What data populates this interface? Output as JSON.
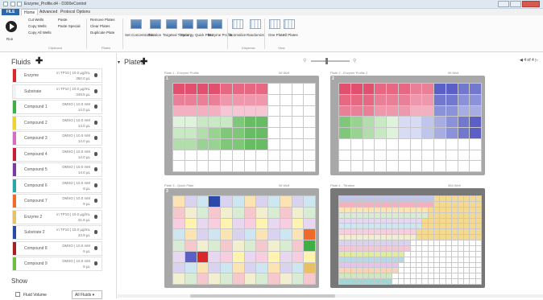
{
  "window": {
    "title": "Enzyme_Profile.d4 - D300eControl"
  },
  "tabs": [
    {
      "label": "FILE"
    },
    {
      "label": "Home"
    },
    {
      "label": "Advanced"
    },
    {
      "label": "Protocol Options"
    }
  ],
  "ribbon": {
    "run": "Run",
    "cut": "Cut Wells",
    "copy": "Copy Wells",
    "copy_all": "Copy All Wells",
    "paste": "Paste",
    "paste_special": "Paste Special",
    "remove_plates": "Remove Plates",
    "clear_plates": "Clear Plates",
    "duplicate_plate": "Duplicate Plate",
    "group_clipboard": "Clipboard",
    "group_plates": "Plates",
    "set_concentration": "Set Concentration",
    "titration": "Titration",
    "targeted_titration": "Targeted Titration",
    "synergy": "Synergy",
    "quick_plate": "Quick Plate",
    "enzyme_profile": "Enzyme Profile",
    "normalize": "Normalize",
    "randomize": "Randomize",
    "group_dispense": "Dispense",
    "one_plate": "One Plate",
    "all_plates": "All Plates",
    "group_view": "View"
  },
  "sidebar": {
    "header": "Fluids",
    "fluids": [
      {
        "name": "Enzyme",
        "conc": "in TP10 | 10.0 µg/mL",
        "vol": "350.0 µL",
        "color": "#d8282a"
      },
      {
        "name": "Substrate",
        "conc": "in TP10 | 10.0 µg/mL",
        "vol": "349.5 µL",
        "color": "#f2f2f2"
      },
      {
        "name": "Compound 1",
        "conc": "DMSO | 10.0 mM",
        "vol": "14.0 µL",
        "color": "#3cb043"
      },
      {
        "name": "Compound 2",
        "conc": "DMSO | 10.0 mM",
        "vol": "14.0 µL",
        "color": "#f1d22b"
      },
      {
        "name": "Compound 3",
        "conc": "DMSO | 10.0 mM",
        "vol": "14.0 µL",
        "color": "#d46cc4"
      },
      {
        "name": "Compound 4",
        "conc": "DMSO | 10.0 mM",
        "vol": "14.0 µL",
        "color": "#c61f3a"
      },
      {
        "name": "Compound 5",
        "conc": "DMSO | 10.0 mM",
        "vol": "14.0 µL",
        "color": "#7a3aa0"
      },
      {
        "name": "Compound 6",
        "conc": "DMSO | 10.0 mM",
        "vol": "9 µL",
        "color": "#2aa7a8"
      },
      {
        "name": "Compound 7",
        "conc": "DMSO | 10.0 mM",
        "vol": "9 µL",
        "color": "#f06a2a"
      },
      {
        "name": "Enzyme 2",
        "conc": "in TP10 | 10.0 µg/mL",
        "vol": "31.8 µL",
        "color": "#e8c066"
      },
      {
        "name": "Substrate 2",
        "conc": "in TP10 | 10.0 µg/mL",
        "vol": "43.9 µL",
        "color": "#2b4aa8"
      },
      {
        "name": "Compound 8",
        "conc": "DMSO | 10.0 mM",
        "vol": "9 µL",
        "color": "#a52020"
      },
      {
        "name": "Compound 9",
        "conc": "DMSO | 10.0 mM",
        "vol": "9 µL",
        "color": "#6bbf3f"
      }
    ],
    "show_header": "Show",
    "show_option": "Fluid Volume",
    "show_select": "All Fluids"
  },
  "main": {
    "header": "Plates",
    "pager": "4 of 4",
    "plates": [
      {
        "num": "1",
        "label": "Plate 1 - Enzyme Profile",
        "info": "96 Well"
      },
      {
        "name": "",
        "num": "2",
        "label": "Plate 2 - Enzyme Profile 2",
        "info": "96 Well"
      },
      {
        "num": "3",
        "label": "Plate 3 - Quick Plate",
        "info": "96 Well"
      },
      {
        "num": "4",
        "label": "Plate 4 - Titration",
        "info": "384 Well"
      }
    ]
  },
  "colors": {
    "pink": "#e8577d",
    "green": "#6fc36a",
    "blue": "#5662c8",
    "ribbon_blue": "#2a6aa9"
  }
}
